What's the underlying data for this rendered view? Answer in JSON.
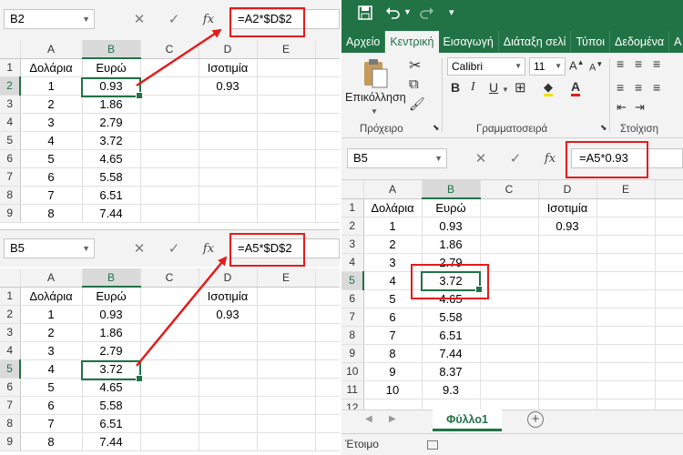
{
  "colors": {
    "accent": "#217346",
    "annotation": "#e41b1b"
  },
  "top_left": {
    "name_box": "B2",
    "formula": "=A2*$D$2",
    "columns": [
      "A",
      "B",
      "C",
      "D",
      "E"
    ],
    "rows": [
      {
        "n": "1",
        "a": "Δολάρια",
        "b": "Ευρώ",
        "d": "Ισοτιμία"
      },
      {
        "n": "2",
        "a": "1",
        "b": "0.93",
        "d": "0.93"
      },
      {
        "n": "3",
        "a": "2",
        "b": "1.86",
        "d": ""
      },
      {
        "n": "4",
        "a": "3",
        "b": "2.79",
        "d": ""
      },
      {
        "n": "5",
        "a": "4",
        "b": "3.72",
        "d": ""
      },
      {
        "n": "6",
        "a": "5",
        "b": "4.65",
        "d": ""
      },
      {
        "n": "7",
        "a": "6",
        "b": "5.58",
        "d": ""
      },
      {
        "n": "8",
        "a": "7",
        "b": "6.51",
        "d": ""
      },
      {
        "n": "9",
        "a": "8",
        "b": "7.44",
        "d": ""
      }
    ]
  },
  "bottom_left": {
    "name_box": "B5",
    "formula": "=A5*$D$2",
    "columns": [
      "A",
      "B",
      "C",
      "D",
      "E"
    ],
    "rows": [
      {
        "n": "1",
        "a": "Δολάρια",
        "b": "Ευρώ",
        "d": "Ισοτιμία"
      },
      {
        "n": "2",
        "a": "1",
        "b": "0.93",
        "d": "0.93"
      },
      {
        "n": "3",
        "a": "2",
        "b": "1.86",
        "d": ""
      },
      {
        "n": "4",
        "a": "3",
        "b": "2.79",
        "d": ""
      },
      {
        "n": "5",
        "a": "4",
        "b": "3.72",
        "d": ""
      },
      {
        "n": "6",
        "a": "5",
        "b": "4.65",
        "d": ""
      },
      {
        "n": "7",
        "a": "6",
        "b": "5.58",
        "d": ""
      },
      {
        "n": "8",
        "a": "7",
        "b": "6.51",
        "d": ""
      },
      {
        "n": "9",
        "a": "8",
        "b": "7.44",
        "d": ""
      }
    ]
  },
  "right": {
    "quick_access": {
      "save_icon": "save-icon",
      "undo_icon": "undo-icon",
      "redo_icon": "redo-icon"
    },
    "tabs": [
      "Αρχείο",
      "Κεντρική",
      "Εισαγωγή",
      "Διάταξη σελί",
      "Τύποι",
      "Δεδομένα",
      "Α"
    ],
    "ribbon": {
      "paste_label": "Επικόλληση",
      "clipboard_label": "Πρόχειρο",
      "font_label": "Γραμματοσειρά",
      "alignment_label": "Στοίχιση",
      "font_name": "Calibri",
      "font_size": "11"
    },
    "name_box": "B5",
    "formula": "=A5*0.93",
    "columns": [
      "A",
      "B",
      "C",
      "D",
      "E"
    ],
    "rows": [
      {
        "n": "1",
        "a": "Δολάρια",
        "b": "Ευρώ",
        "d": "Ισοτιμία"
      },
      {
        "n": "2",
        "a": "1",
        "b": "0.93",
        "d": "0.93"
      },
      {
        "n": "3",
        "a": "2",
        "b": "1.86",
        "d": ""
      },
      {
        "n": "4",
        "a": "3",
        "b": "2.79",
        "d": ""
      },
      {
        "n": "5",
        "a": "4",
        "b": "3.72",
        "d": ""
      },
      {
        "n": "6",
        "a": "5",
        "b": "4.65",
        "d": ""
      },
      {
        "n": "7",
        "a": "6",
        "b": "5.58",
        "d": ""
      },
      {
        "n": "8",
        "a": "7",
        "b": "6.51",
        "d": ""
      },
      {
        "n": "9",
        "a": "8",
        "b": "7.44",
        "d": ""
      },
      {
        "n": "10",
        "a": "9",
        "b": "8.37",
        "d": ""
      },
      {
        "n": "11",
        "a": "10",
        "b": "9.3",
        "d": ""
      },
      {
        "n": "12",
        "a": "",
        "b": "",
        "d": ""
      }
    ],
    "sheet_tab": "Φύλλο1",
    "status": "Έτοιμο"
  }
}
